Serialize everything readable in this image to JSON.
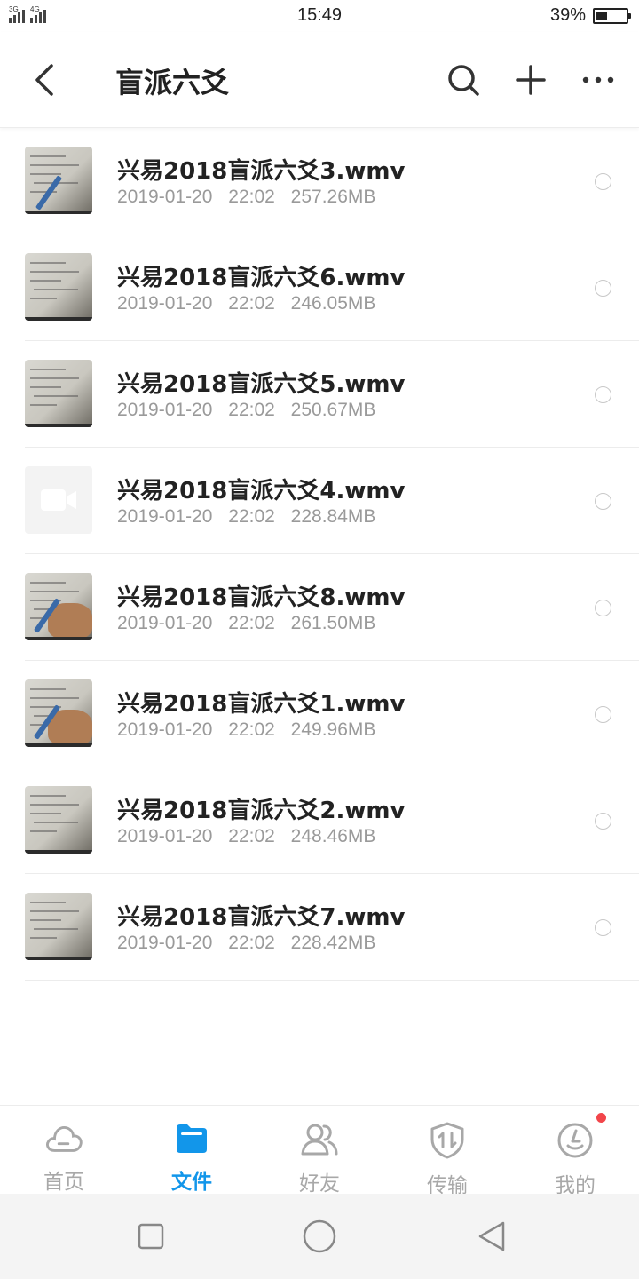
{
  "status_bar": {
    "net1": "3G",
    "net2": "4G",
    "time": "15:49",
    "battery_percent": "39%",
    "battery_level": 0.39
  },
  "header": {
    "title": "盲派六爻"
  },
  "files": [
    {
      "name": "兴易2018盲派六爻3.wmv",
      "date": "2019-01-20",
      "time": "22:02",
      "size": "257.26MB",
      "thumb": "writing-pen"
    },
    {
      "name": "兴易2018盲派六爻6.wmv",
      "date": "2019-01-20",
      "time": "22:02",
      "size": "246.05MB",
      "thumb": "paper"
    },
    {
      "name": "兴易2018盲派六爻5.wmv",
      "date": "2019-01-20",
      "time": "22:02",
      "size": "250.67MB",
      "thumb": "paper-lines"
    },
    {
      "name": "兴易2018盲派六爻4.wmv",
      "date": "2019-01-20",
      "time": "22:02",
      "size": "228.84MB",
      "thumb": "placeholder-video-icon"
    },
    {
      "name": "兴易2018盲派六爻8.wmv",
      "date": "2019-01-20",
      "time": "22:02",
      "size": "261.50MB",
      "thumb": "writing-hand"
    },
    {
      "name": "兴易2018盲派六爻1.wmv",
      "date": "2019-01-20",
      "time": "22:02",
      "size": "249.96MB",
      "thumb": "writing-hand"
    },
    {
      "name": "兴易2018盲派六爻2.wmv",
      "date": "2019-01-20",
      "time": "22:02",
      "size": "248.46MB",
      "thumb": "paper-lines"
    },
    {
      "name": "兴易2018盲派六爻7.wmv",
      "date": "2019-01-20",
      "time": "22:02",
      "size": "228.42MB",
      "thumb": "paper-lines"
    }
  ],
  "bottom_nav": {
    "items": [
      {
        "label": "首页",
        "icon": "cloud-icon",
        "active": false
      },
      {
        "label": "文件",
        "icon": "folder-icon",
        "active": true
      },
      {
        "label": "好友",
        "icon": "friends-icon",
        "active": false
      },
      {
        "label": "传输",
        "icon": "transfer-shield-icon",
        "active": false
      },
      {
        "label": "我的",
        "icon": "profile-face-icon",
        "active": false,
        "badge": true
      }
    ]
  },
  "colors": {
    "accent": "#1296ea",
    "inactive": "#a8a8a8",
    "badge": "#f2454a",
    "meta_text": "#9a9a9a"
  }
}
